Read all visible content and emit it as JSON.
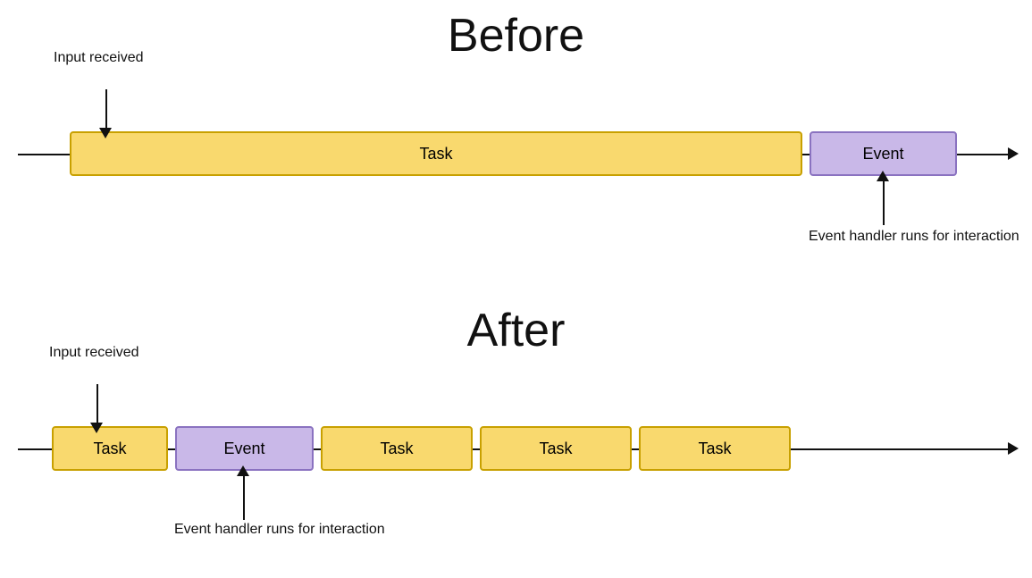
{
  "before": {
    "title": "Before",
    "input_label": "Input\nreceived",
    "task_label": "Task",
    "event_label": "Event",
    "event_handler_label": "Event handler\nruns for interaction"
  },
  "after": {
    "title": "After",
    "input_label": "Input\nreceived",
    "task_label": "Task",
    "event_label": "Event",
    "event_handler_label": "Event handler\nruns for interaction",
    "task2_label": "Task",
    "task3_label": "Task",
    "task4_label": "Task"
  },
  "colors": {
    "yellow_bg": "#f9d96e",
    "yellow_border": "#c8a000",
    "purple_bg": "#c9b8e8",
    "purple_border": "#8a72c0",
    "line": "#111111"
  }
}
